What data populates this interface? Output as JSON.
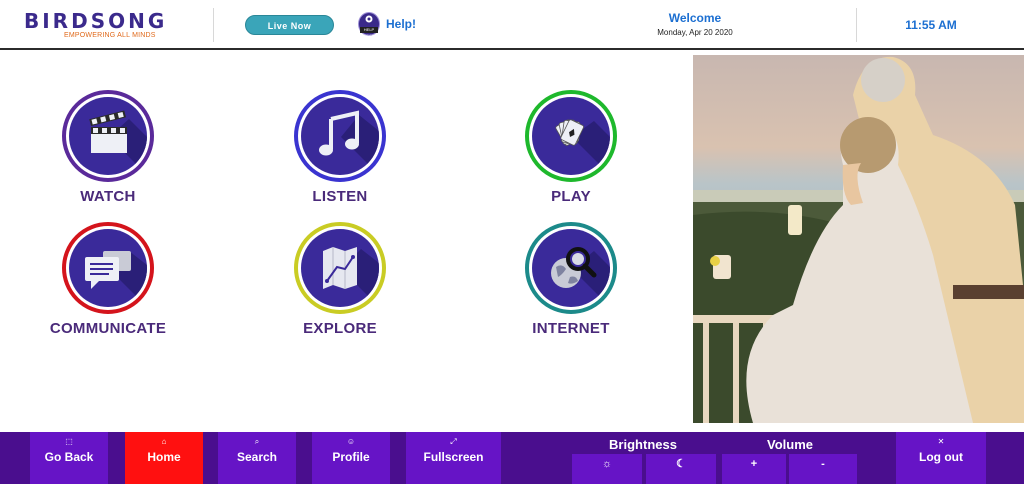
{
  "header": {
    "logo_name": "BIRDSONG",
    "logo_tagline": "EMPOWERING ALL MINDS",
    "live_label": "Live Now",
    "help_badge": "HELP DESK",
    "help_label": "Help!",
    "welcome_title": "Welcome",
    "welcome_date": "Monday, Apr 20 2020",
    "time": "11:55 AM"
  },
  "tiles": [
    {
      "label": "WATCH",
      "ring_color": "#5a2a9a"
    },
    {
      "label": "LISTEN",
      "ring_color": "#3a34d0"
    },
    {
      "label": "PLAY",
      "ring_color": "#1eb82c"
    },
    {
      "label": "COMMUNICATE",
      "ring_color": "#d4141c"
    },
    {
      "label": "EXPLORE",
      "ring_color": "#c9cc24"
    },
    {
      "label": "INTERNET",
      "ring_color": "#1c8a8a"
    }
  ],
  "nav": {
    "back": {
      "label": "Go Back",
      "icon": "back-icon"
    },
    "home": {
      "label": "Home",
      "icon": "home-icon"
    },
    "search": {
      "label": "Search",
      "icon": "search-icon"
    },
    "profile": {
      "label": "Profile",
      "icon": "profile-icon"
    },
    "fullscreen": {
      "label": "Fullscreen",
      "icon": "fullscreen-icon"
    },
    "logout": {
      "label": "Log out",
      "icon": "close-icon"
    }
  },
  "brightness": {
    "title": "Brightness",
    "up_icon": "☼",
    "down_icon": "☾"
  },
  "volume": {
    "title": "Volume",
    "up_label": "+",
    "down_label": "-"
  },
  "colors": {
    "bar_bg": "#4a0e8e",
    "button_bg": "#6614c6",
    "active_bg": "#ff1010",
    "label_purple": "#4a2a7a",
    "link_blue": "#1c6fd1"
  }
}
